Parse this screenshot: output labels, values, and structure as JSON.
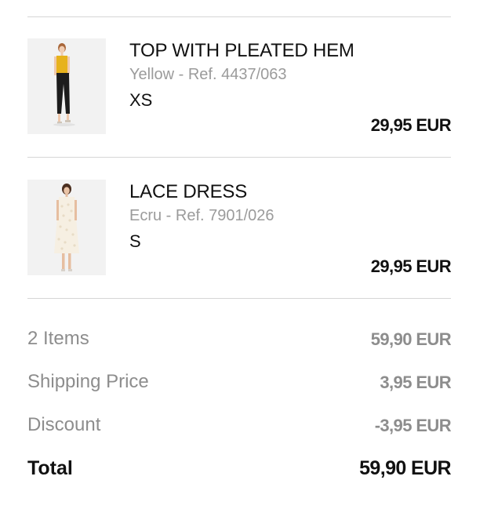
{
  "items": [
    {
      "name": "TOP WITH PLEATED HEM",
      "color_ref": "Yellow - Ref. 4437/063",
      "size": "XS",
      "price": "29,95 EUR",
      "image": "model-yellow-top-photo"
    },
    {
      "name": "LACE DRESS",
      "color_ref": "Ecru - Ref. 7901/026",
      "size": "S",
      "price": "29,95 EUR",
      "image": "model-lace-dress-photo"
    }
  ],
  "summary": {
    "items_label": "2 Items",
    "items_value": "59,90 EUR",
    "shipping_label": "Shipping Price",
    "shipping_value": "3,95 EUR",
    "discount_label": "Discount",
    "discount_value": "-3,95 EUR",
    "total_label": "Total",
    "total_value": "59,90 EUR"
  },
  "colors": {
    "primary_text": "#111111",
    "secondary_text": "#9b9b9b",
    "summary_text": "#8d8d8d",
    "divider": "#d6d6d6"
  }
}
